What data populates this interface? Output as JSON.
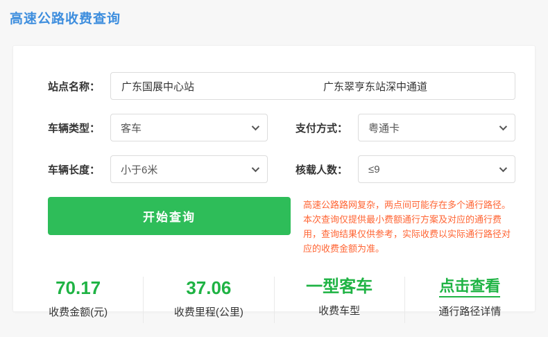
{
  "page": {
    "title": "高速公路收费查询"
  },
  "form": {
    "station": {
      "label": "站点名称：",
      "start_value": "广东国展中心站",
      "end_value": "广东翠亨东站深中通道"
    },
    "vehicle_type": {
      "label": "车辆类型：",
      "value": "客车"
    },
    "payment_method": {
      "label": "支付方式：",
      "value": "粤通卡"
    },
    "vehicle_length": {
      "label": "车辆长度：",
      "value": "小于6米"
    },
    "passenger_capacity": {
      "label": "核载人数：",
      "value": "≤9"
    },
    "submit_label": "开始查询",
    "notice": "高速公路路网复杂，两点间可能存在多个通行路径。本次查询仅提供最小费额通行方案及对应的通行费用，查询结果仅供参考，实际收费以实际通行路径对应的收费金额为准。"
  },
  "results": [
    {
      "value": "70.17",
      "label": "收费金额(元)"
    },
    {
      "value": "37.06",
      "label": "收费里程(公里)"
    },
    {
      "value": "一型客车",
      "label": "收费车型"
    },
    {
      "value": "点击查看",
      "label": "通行路径详情"
    }
  ],
  "colors": {
    "title_blue": "#3e8ede",
    "button_green": "#2ebd59",
    "result_green": "#1fb344",
    "notice_orange": "#ff6433",
    "page_background": "#f7f7f7"
  },
  "icons": {
    "dropdown": "chevron-down"
  }
}
